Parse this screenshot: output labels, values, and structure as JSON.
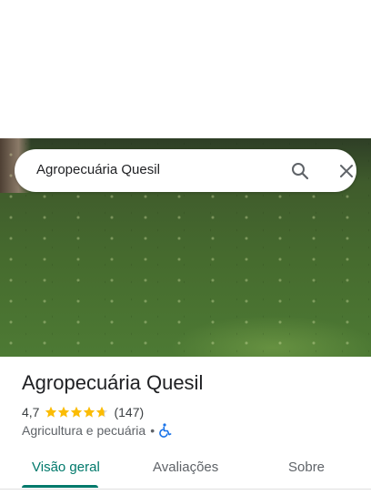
{
  "search": {
    "query": "Agropecuária Quesil"
  },
  "place": {
    "name": "Agropecuária Quesil",
    "rating": "4,7",
    "stars": 4.7,
    "reviews": "(147)",
    "category": "Agricultura e pecuária",
    "separator": "•"
  },
  "tabs": [
    {
      "label": "Visão geral",
      "active": true
    },
    {
      "label": "Avaliações",
      "active": false
    },
    {
      "label": "Sobre",
      "active": false
    }
  ],
  "colors": {
    "accent": "#00796b",
    "star": "#fbbc04",
    "star_empty": "#dadce0",
    "accessibility": "#1a73e8"
  },
  "icons": {
    "search": "search-icon",
    "close": "close-icon",
    "accessibility": "wheelchair-icon"
  }
}
